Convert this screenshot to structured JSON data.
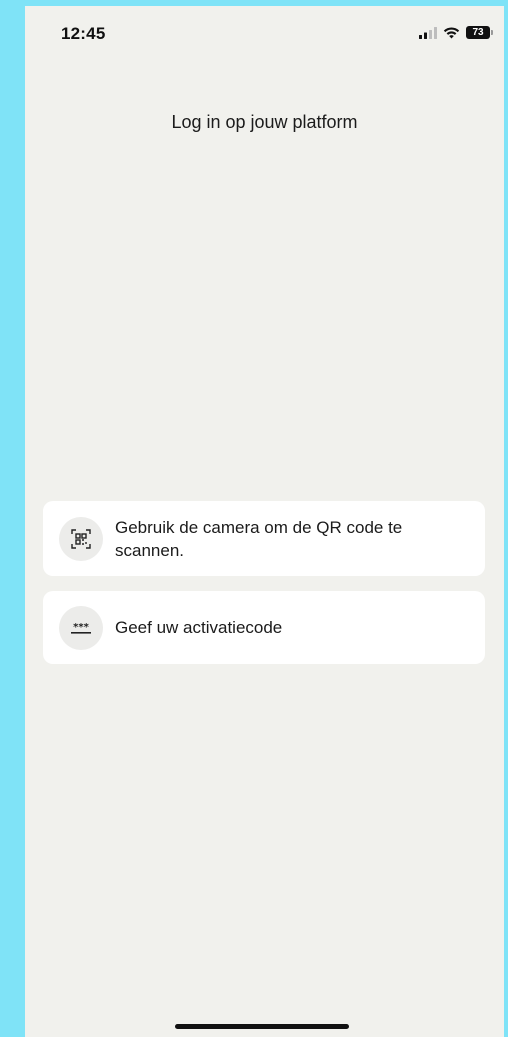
{
  "status_bar": {
    "time": "12:45",
    "battery_level": "73",
    "icons": [
      "signal-icon",
      "wifi-icon",
      "battery-icon"
    ]
  },
  "title": "Log in op jouw platform",
  "options": [
    {
      "icon": "qr-code-icon",
      "label": "Gebruik de camera om de QR code te scannen."
    },
    {
      "icon": "password-icon",
      "label": "Geef uw activatiecode"
    }
  ],
  "colors": {
    "frame_background": "#7fe3f7",
    "screen_background": "#f1f1ed",
    "card_background": "#ffffff",
    "icon_background": "#ececea",
    "text": "#1b1b1b"
  }
}
